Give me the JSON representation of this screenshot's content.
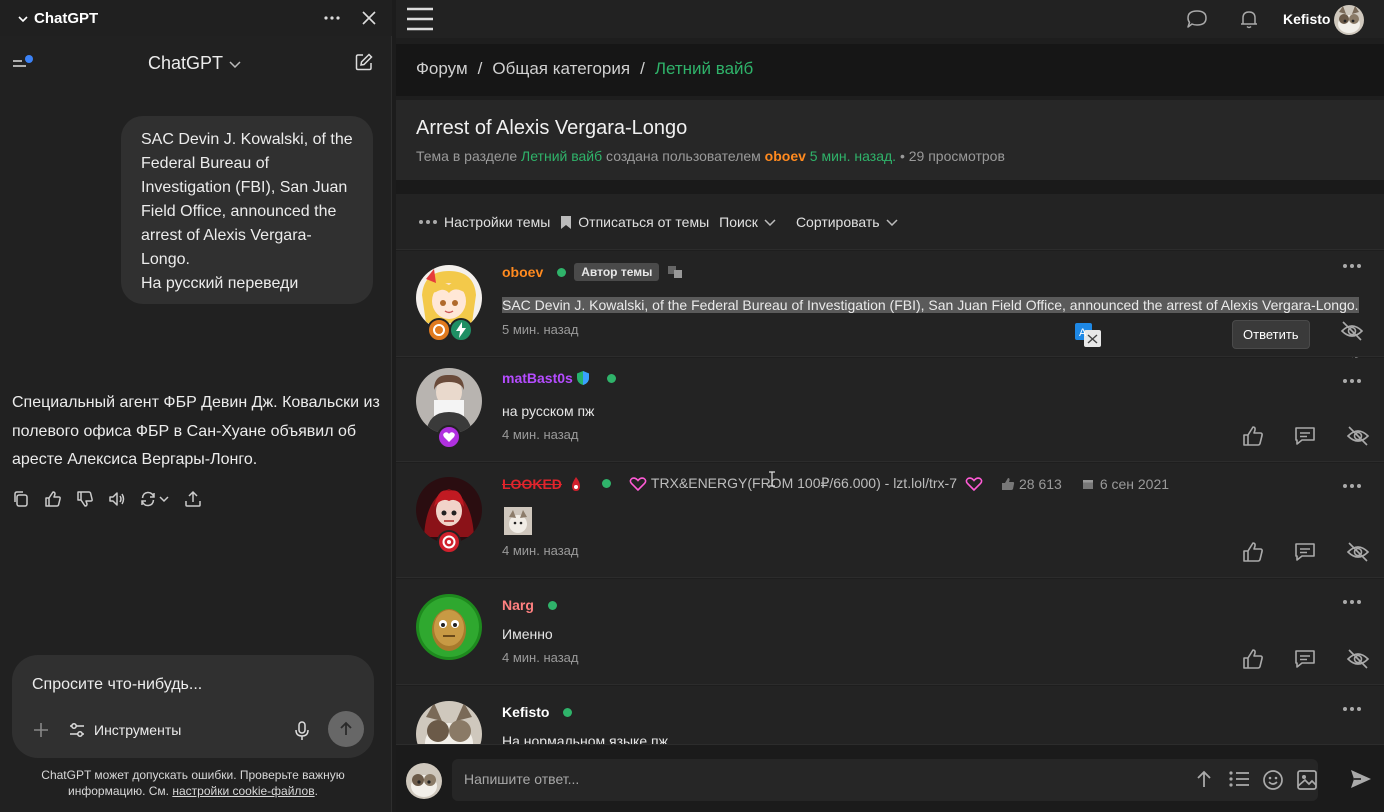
{
  "chatgpt": {
    "window_title": "ChatGPT",
    "model_label": "ChatGPT",
    "user_message": " SAC Devin J. Kowalski, of the\nFederal Bureau of\nInvestigation (FBI), San Juan\nField Office, announced the\narrest of Alexis Vergara-\nLongo.\nНа русский переведи",
    "assistant_message": "Специальный агент ФБР Девин Дж. Ковальски из полевого офиса ФБР в Сан-Хуане объявил об аресте Алексиса Вергары-Лонго.",
    "composer_placeholder": "Спросите что-нибудь...",
    "tools_label": "Инструменты",
    "disclaimer_text": "ChatGPT может допускать ошибки. Проверьте важную информацию. См. ",
    "disclaimer_link": "настройки cookie-файлов",
    "disclaimer_end": "."
  },
  "forum": {
    "username": "Kefisto",
    "breadcrumbs": [
      "Форум",
      "/",
      "Общая категория",
      "/",
      "Летний вайб"
    ],
    "thread": {
      "title": "Arrest of Alexis Vergara-Longo",
      "meta_prefix": "Тема в разделе ",
      "section": "Летний вайб",
      "meta_mid": " создана пользователем ",
      "author": "oboev",
      "created": " 5 мин. назад.",
      "views": " • 29 просмотров"
    },
    "toolbar": {
      "settings": "Настройки темы",
      "unsubscribe": "Отписаться от темы",
      "search": "Поиск",
      "sort": "Сортировать"
    },
    "posts": [
      {
        "author": "oboev",
        "author_color": "#ff8a1f",
        "badge": "Автор темы",
        "text": "SAC Devin J. Kowalski, of the Federal Bureau of Investigation (FBI), San Juan Field Office, announced the arrest of Alexis Vergara-Longo.",
        "time": "5 мин. назад",
        "reply_tooltip": "Ответить"
      },
      {
        "author": "matBast0s",
        "author_color": "#b54cff",
        "text": "на русском пж",
        "time": "4 мин. назад"
      },
      {
        "author": "LOOKED",
        "author_color": "#e0242c",
        "status": "TRX&ENERGY(FROM 100₽/66.000) - lzt.lol/trx-7",
        "likes": "28 613",
        "joined": "6 сен 2021",
        "time": "4 мин. назад"
      },
      {
        "author": "Narg",
        "author_color": "#ff8080",
        "text": "Именно",
        "time": "4 мин. назад"
      },
      {
        "author": "Kefisto",
        "author_color": "#ffffff",
        "text": "На нормальном языке пж"
      }
    ],
    "reply_placeholder": "Напишите ответ..."
  },
  "colors": {
    "accent_green": "#2fb36a",
    "online": "#2fb36a",
    "author_orange": "#ff8a1f"
  }
}
